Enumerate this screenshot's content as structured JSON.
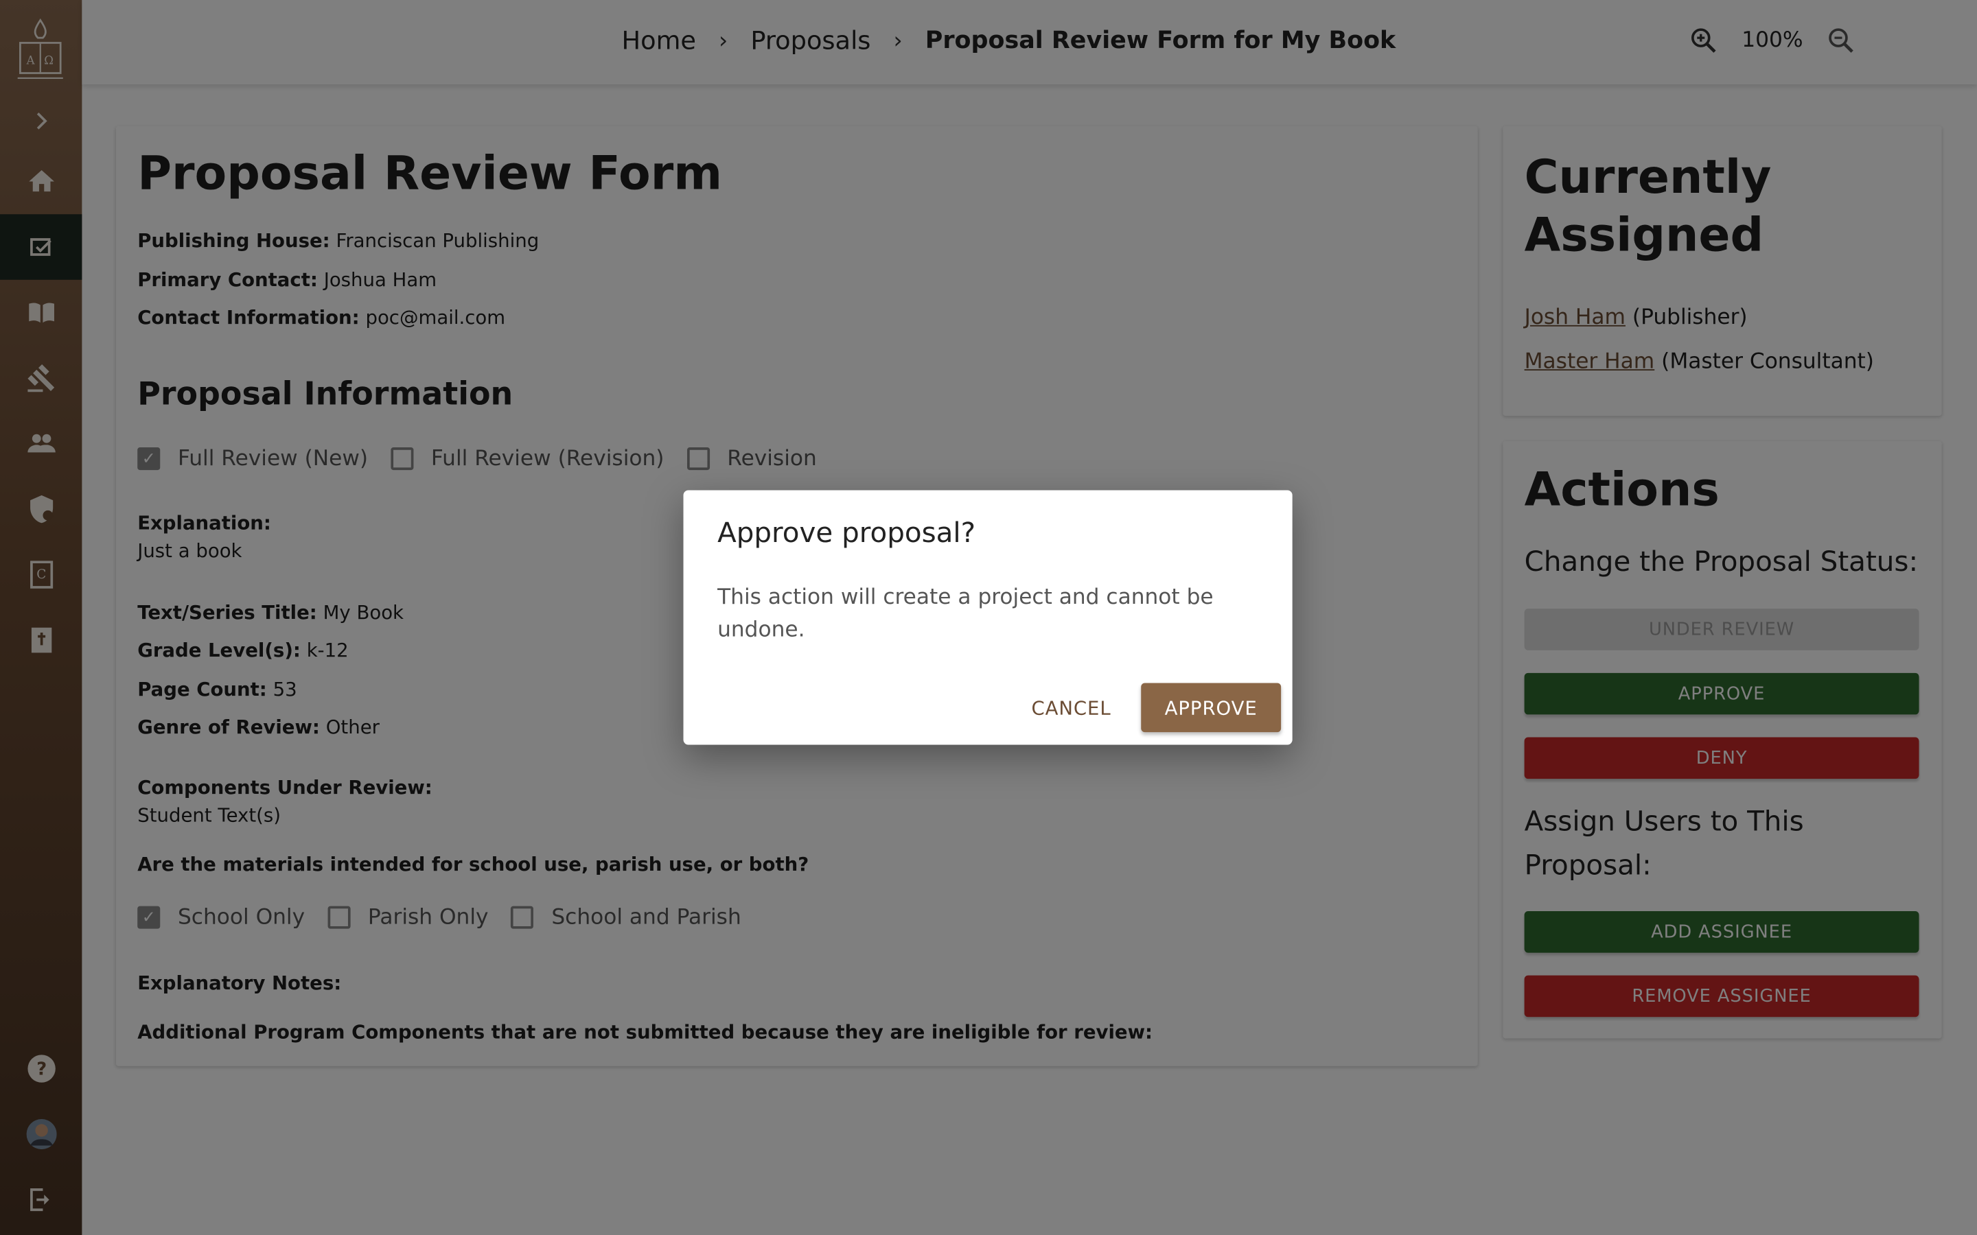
{
  "breadcrumb": {
    "home": "Home",
    "proposals": "Proposals",
    "current": "Proposal Review Form for My Book"
  },
  "zoom": {
    "level": "100%"
  },
  "form": {
    "title": "Proposal Review Form",
    "publishing_house_label": "Publishing House:",
    "publishing_house_value": "Franciscan Publishing",
    "primary_contact_label": "Primary Contact:",
    "primary_contact_value": "Joshua Ham",
    "contact_info_label": "Contact Information:",
    "contact_info_value": "poc@mail.com",
    "proposal_info_heading": "Proposal Information",
    "review_types": [
      {
        "label": "Full Review (New)",
        "checked": true
      },
      {
        "label": "Full Review (Revision)",
        "checked": false
      },
      {
        "label": "Revision",
        "checked": false
      }
    ],
    "explanation_label": "Explanation:",
    "explanation_value": "Just a book",
    "text_title_label": "Text/Series Title:",
    "text_title_value": "My Book",
    "grade_label": "Grade Level(s):",
    "grade_value": "k-12",
    "page_count_label": "Page Count:",
    "page_count_value": "53",
    "genre_label": "Genre of Review:",
    "genre_value": "Other",
    "components_label": "Components Under Review:",
    "components_value": "Student Text(s)",
    "materials_question": "Are the materials intended for school use, parish use, or both?",
    "usage": [
      {
        "label": "School Only",
        "checked": true
      },
      {
        "label": "Parish Only",
        "checked": false
      },
      {
        "label": "School and Parish",
        "checked": false
      }
    ],
    "explanatory_notes_label": "Explanatory Notes:",
    "additional_components_label": "Additional Program Components that are not submitted because they are ineligible for review:"
  },
  "assigned": {
    "title": "Currently Assigned",
    "users": [
      {
        "name": "Josh Ham",
        "role": "(Publisher)"
      },
      {
        "name": "Master Ham",
        "role": "(Master Consultant)"
      }
    ]
  },
  "actions": {
    "title": "Actions",
    "change_status_label": "Change the Proposal Status:",
    "under_review": "UNDER REVIEW",
    "approve": "APPROVE",
    "deny": "DENY",
    "assign_label": "Assign Users to This Proposal:",
    "add_assignee": "ADD ASSIGNEE",
    "remove_assignee": "REMOVE ASSIGNEE"
  },
  "dialog": {
    "title": "Approve proposal?",
    "message": "This action will create a project and cannot be undone.",
    "cancel": "CANCEL",
    "approve": "APPROVE"
  },
  "colors": {
    "brand_brown": "#8a6646",
    "approve_green": "#2f6b2f",
    "deny_red": "#c62828",
    "active_nav": "#1f2a22"
  },
  "sidebar": {
    "icons": [
      "logo",
      "expand-icon",
      "home-icon",
      "proposals-icon",
      "book-icon",
      "gavel-icon",
      "people-icon",
      "shield-icon",
      "catechism-icon",
      "bible-icon",
      "help-icon",
      "avatar",
      "logout-icon"
    ]
  }
}
